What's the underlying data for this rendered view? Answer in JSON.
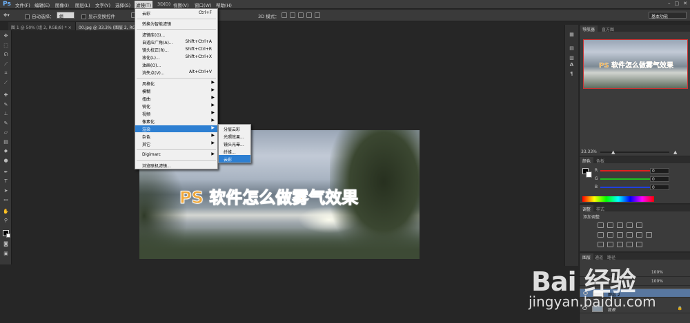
{
  "app": {
    "logo": "Ps"
  },
  "menubar": {
    "items": [
      "文件(F)",
      "编辑(E)",
      "图像(I)",
      "图层(L)",
      "文字(Y)",
      "选择(S)",
      "滤镜(T)",
      "3D(D)",
      "视图(V)",
      "窗口(W)",
      "帮助(H)"
    ],
    "active_index": 6,
    "window_controls": [
      "–",
      "□",
      "✕"
    ]
  },
  "options": {
    "auto_select_label": "自动选择：",
    "auto_select_value": "组",
    "show_transform_label": "显示变换控件",
    "mode_3d_label": "3D 模式：",
    "workspace": "基本功能"
  },
  "tabs": [
    {
      "label": "图 1 @ 50% (组 2, RGB/8) *",
      "close": "×"
    },
    {
      "label": "00.jpg @ 33.3% (图层 2, RGB",
      "close": ""
    }
  ],
  "filter_menu": {
    "items": [
      {
        "label": "云彩",
        "shortcut": "Ctrl+F"
      },
      {
        "sep": true
      },
      {
        "label": "转换为智能滤镜"
      },
      {
        "sep": true
      },
      {
        "label": "滤镜库(G)..."
      },
      {
        "label": "自适应广角(A)...",
        "shortcut": "Shift+Ctrl+A"
      },
      {
        "label": "镜头校正(R)...",
        "shortcut": "Shift+Ctrl+R"
      },
      {
        "label": "液化(L)...",
        "shortcut": "Shift+Ctrl+X"
      },
      {
        "label": "油画(O)..."
      },
      {
        "label": "消失点(V)...",
        "shortcut": "Alt+Ctrl+V"
      },
      {
        "sep": true
      },
      {
        "label": "风格化",
        "submenu": true
      },
      {
        "label": "模糊",
        "submenu": true
      },
      {
        "label": "扭曲",
        "submenu": true
      },
      {
        "label": "锐化",
        "submenu": true
      },
      {
        "label": "视频",
        "submenu": true
      },
      {
        "label": "像素化",
        "submenu": true
      },
      {
        "label": "渲染",
        "submenu": true,
        "highlighted": true
      },
      {
        "label": "杂色",
        "submenu": true
      },
      {
        "label": "其它",
        "submenu": true
      },
      {
        "sep": true
      },
      {
        "label": "Digimarc",
        "submenu": true
      },
      {
        "sep": true
      },
      {
        "label": "浏览联机滤镜..."
      }
    ]
  },
  "render_submenu": {
    "items": [
      "分层云彩",
      "光照效果...",
      "镜头光晕...",
      "纤维...",
      "云彩"
    ],
    "highlighted_index": 4
  },
  "canvas": {
    "title_text": "PS 软件怎么做雾气效果"
  },
  "navigator": {
    "tabs": [
      "导航器",
      "直方图"
    ],
    "thumb_text": "PS 软件怎么做雾气效果",
    "zoom": "33.33%"
  },
  "color_panel": {
    "tabs": [
      "颜色",
      "色板"
    ],
    "channels": [
      {
        "label": "R",
        "value": "0",
        "color": "#e02020"
      },
      {
        "label": "G",
        "value": "0",
        "color": "#20c020"
      },
      {
        "label": "B",
        "value": "0",
        "color": "#2040e0"
      }
    ]
  },
  "adjust_panel": {
    "tabs": [
      "调整",
      "样式"
    ],
    "heading": "添加调整"
  },
  "layers_panel": {
    "tabs": [
      "图层",
      "通道",
      "路径"
    ],
    "rows": [
      {
        "name": "",
        "opacity": "100%"
      },
      {
        "name": "",
        "opacity": "100%"
      },
      {
        "name": "图层 2",
        "selected": true
      },
      {
        "name": "背景"
      }
    ]
  },
  "watermark": {
    "logo": "Bai 经验",
    "url": "jingyan.baidu.com"
  }
}
